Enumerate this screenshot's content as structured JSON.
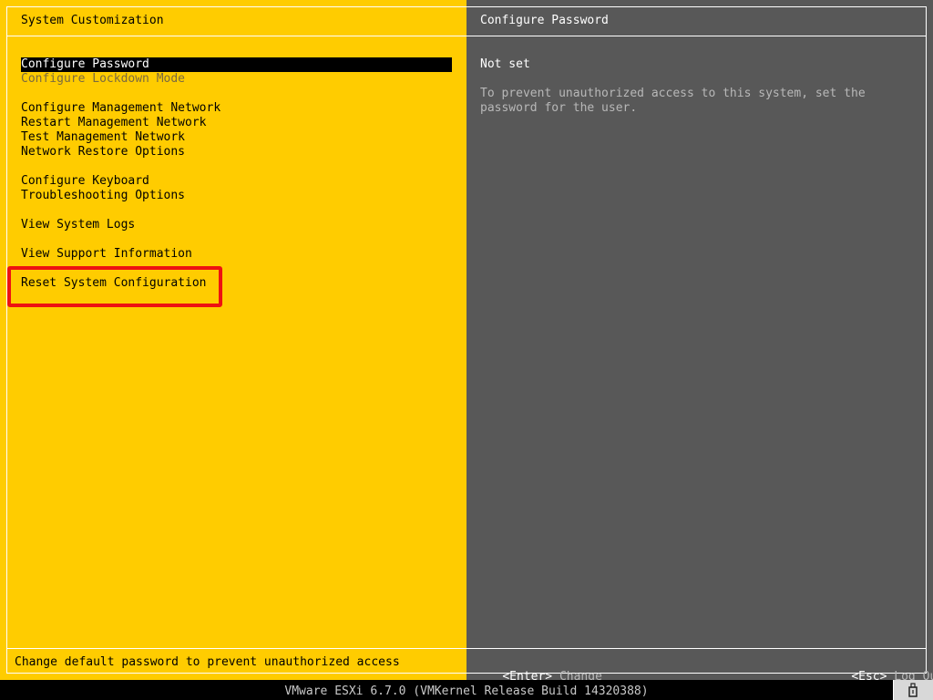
{
  "left": {
    "title": "System Customization",
    "menu": [
      {
        "label": "Configure Password",
        "selected": true
      },
      {
        "label": "Configure Lockdown Mode",
        "disabled": true
      },
      {
        "label": "Configure Management Network"
      },
      {
        "label": "Restart Management Network"
      },
      {
        "label": "Test Management Network"
      },
      {
        "label": "Network Restore Options"
      },
      {
        "label": "Configure Keyboard"
      },
      {
        "label": "Troubleshooting Options"
      },
      {
        "label": "View System Logs"
      },
      {
        "label": "View Support Information"
      },
      {
        "label": "Reset System Configuration"
      }
    ],
    "footer": "Change default password to prevent unauthorized access"
  },
  "right": {
    "title": "Configure Password",
    "status": "Not set",
    "description": "To prevent unauthorized access to this system, set the\npassword for the user.",
    "footer_enter_key": "<Enter>",
    "footer_enter_action": "Change",
    "footer_esc_key": "<Esc>",
    "footer_esc_action": "Log Out"
  },
  "status_bar": "VMware ESXi 6.7.0 (VMKernel Release Build 14320388)",
  "icons": {
    "tray": "usb-drive-icon"
  },
  "colors": {
    "left_bg": "#ffcc00",
    "right_bg": "#585858",
    "highlight": "#ee1111"
  }
}
